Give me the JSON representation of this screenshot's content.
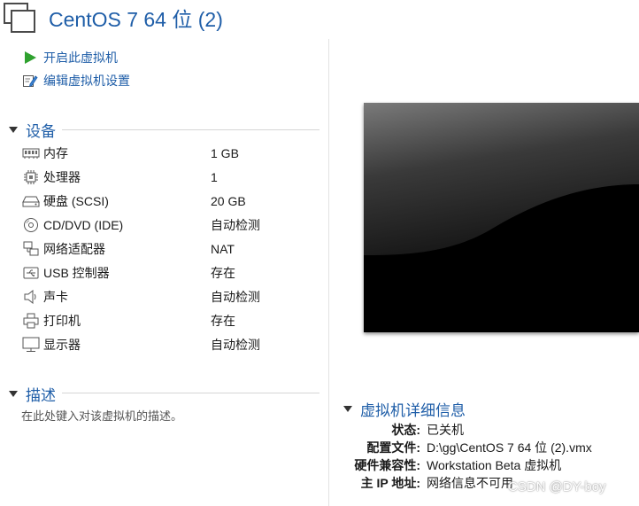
{
  "window": {
    "title": "CentOS 7 64 位 (2)"
  },
  "actions": [
    {
      "label": "开启此虚拟机",
      "icon": "play-icon"
    },
    {
      "label": "编辑虚拟机设置",
      "icon": "edit-settings-icon"
    }
  ],
  "devices": {
    "header": "设备",
    "items": [
      {
        "name": "内存",
        "value": "1 GB",
        "icon": "memory-icon"
      },
      {
        "name": "处理器",
        "value": "1",
        "icon": "processor-icon"
      },
      {
        "name": "硬盘 (SCSI)",
        "value": "20 GB",
        "icon": "hard-disk-icon"
      },
      {
        "name": "CD/DVD (IDE)",
        "value": "自动检测",
        "icon": "cd-dvd-icon"
      },
      {
        "name": "网络适配器",
        "value": "NAT",
        "icon": "network-adapter-icon"
      },
      {
        "name": "USB 控制器",
        "value": "存在",
        "icon": "usb-icon"
      },
      {
        "name": "声卡",
        "value": "自动检测",
        "icon": "sound-card-icon"
      },
      {
        "name": "打印机",
        "value": "存在",
        "icon": "printer-icon"
      },
      {
        "name": "显示器",
        "value": "自动检测",
        "icon": "display-icon"
      }
    ]
  },
  "description": {
    "header": "描述",
    "placeholder": "在此处键入对该虚拟机的描述。"
  },
  "details": {
    "header": "虚拟机详细信息",
    "rows": [
      {
        "key": "状态:",
        "value": "已关机"
      },
      {
        "key": "配置文件:",
        "value": "D:\\gg\\CentOS 7 64 位 (2).vmx"
      },
      {
        "key": "硬件兼容性:",
        "value": "Workstation Beta 虚拟机"
      },
      {
        "key": "主 IP 地址:",
        "value": "网络信息不可用"
      }
    ]
  },
  "watermark": "CSDN @DY-boy",
  "colors": {
    "accent": "#1f5ea8",
    "play": "#2fa12f",
    "preview_bg": "#000000"
  }
}
